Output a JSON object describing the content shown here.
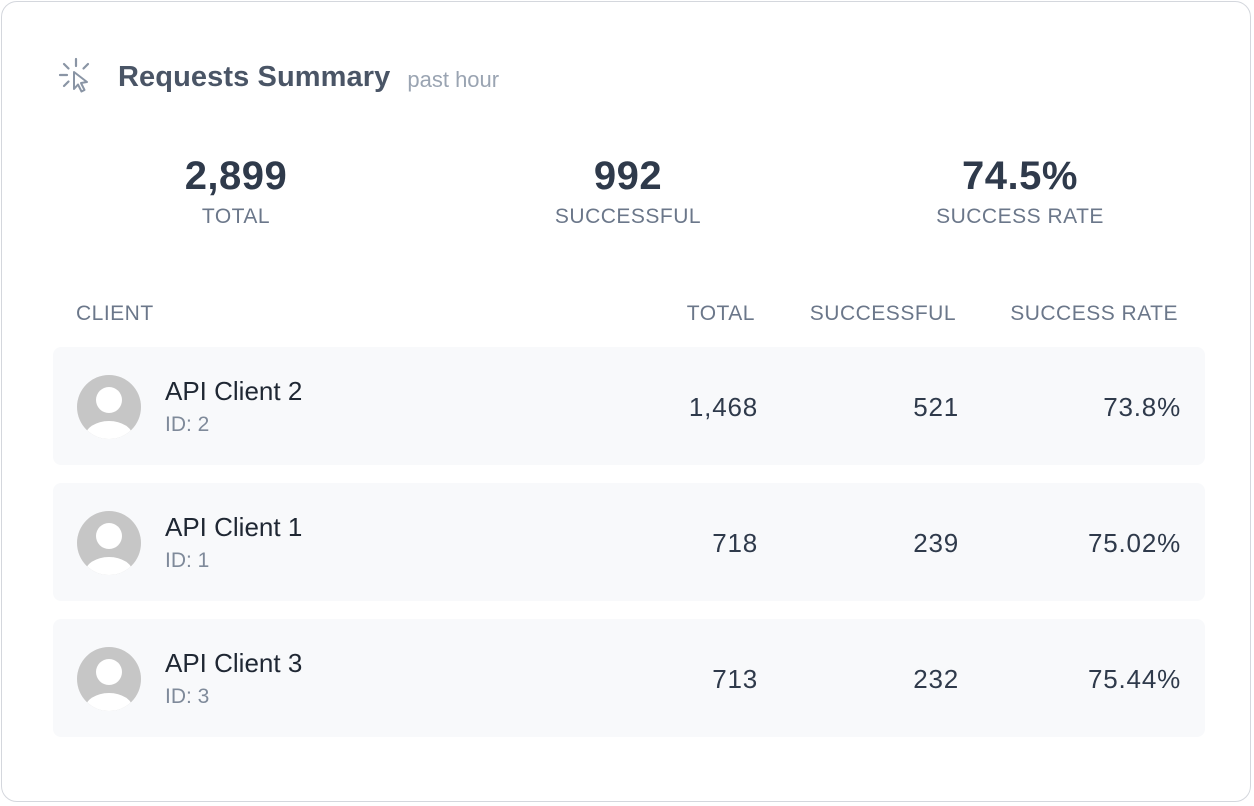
{
  "header": {
    "title": "Requests Summary",
    "subtitle": "past hour",
    "icon": "cursor-click-icon"
  },
  "stats": {
    "total": {
      "value": "2,899",
      "label": "TOTAL"
    },
    "successful": {
      "value": "992",
      "label": "SUCCESSFUL"
    },
    "rate": {
      "value": "74.5%",
      "label": "SUCCESS RATE"
    }
  },
  "table": {
    "headers": {
      "client": "CLIENT",
      "total": "TOTAL",
      "successful": "SUCCESSFUL",
      "rate": "SUCCESS RATE"
    },
    "rows": [
      {
        "name": "API Client 2",
        "id": "ID: 2",
        "total": "1,468",
        "successful": "521",
        "rate": "73.8%"
      },
      {
        "name": "API Client 1",
        "id": "ID: 1",
        "total": "718",
        "successful": "239",
        "rate": "75.02%"
      },
      {
        "name": "API Client 3",
        "id": "ID: 3",
        "total": "713",
        "successful": "232",
        "rate": "75.44%"
      }
    ]
  },
  "colors": {
    "row_bg": "#f8f9fb",
    "avatar": "#c6c6c6",
    "text_dark": "#2f3a4b",
    "text_muted": "#6b778a"
  }
}
